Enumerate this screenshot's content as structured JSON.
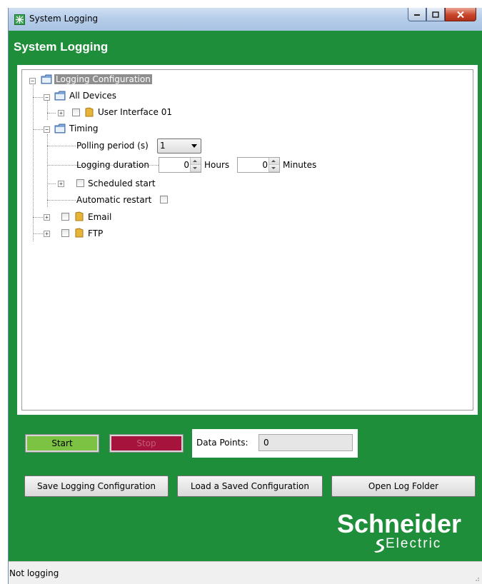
{
  "window": {
    "title": "System Logging",
    "header": "System Logging"
  },
  "tree": {
    "root": "Logging Configuration",
    "all_devices": "All Devices",
    "user_interface": "User Interface 01",
    "timing": "Timing",
    "polling_label": "Polling period (s)",
    "polling_value": "1",
    "duration_label": "Logging duration",
    "hours_value": "0",
    "hours_label": "Hours",
    "minutes_value": "0",
    "minutes_label": "Minutes",
    "scheduled_start": "Scheduled start",
    "automatic_restart": "Automatic restart",
    "email": "Email",
    "ftp": "FTP"
  },
  "controls": {
    "start_label": "Start",
    "stop_label": "Stop",
    "data_points_label": "Data Points:",
    "data_points_value": "0",
    "save_label": "Save Logging Configuration",
    "load_label": "Load a Saved Configuration",
    "open_label": "Open Log Folder"
  },
  "logo": {
    "brand_top": "Schneider",
    "brand_bottom": "Electric"
  },
  "status": {
    "text": "Not logging"
  },
  "colors": {
    "window_bg": "#1f8e3a",
    "start": "#7cc243",
    "stop": "#a6143d"
  }
}
